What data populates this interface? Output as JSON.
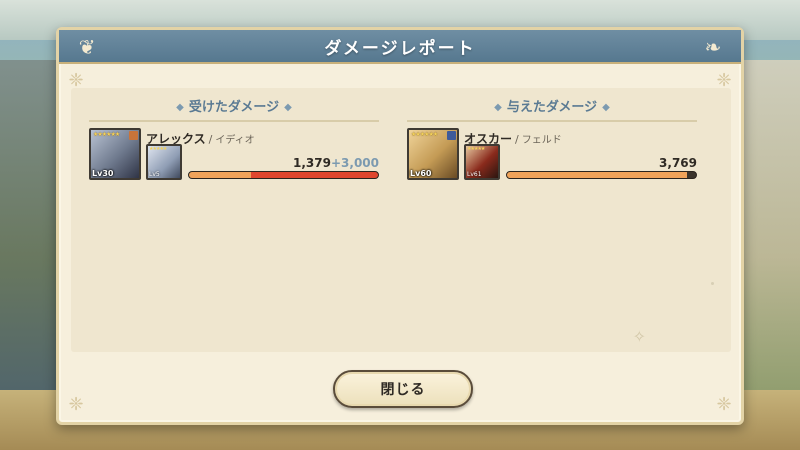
{
  "dialog": {
    "title": "ダメージレポート",
    "close_label": "閉じる"
  },
  "received": {
    "heading": "受けたダメージ",
    "character": {
      "name": "アレックス",
      "separator": "/",
      "sub_name": "イディオ",
      "level": "Lv30",
      "sub_level": "Lv5",
      "damage": "1,379",
      "bonus": "+3,000",
      "bar_primary_fraction": 0.33,
      "bar_bonus_fraction": 0.67
    }
  },
  "dealt": {
    "heading": "与えたダメージ",
    "character": {
      "name": "オスカー",
      "separator": "/",
      "sub_name": "フェルド",
      "level": "Lv60",
      "sub_level": "Lv61",
      "damage": "3,769",
      "bar_primary_fraction": 0.95
    }
  },
  "icons": {
    "header_flourish": "scroll-flourish-icon",
    "title_diamond": "diamond-icon",
    "sparkle": "sparkle-icon"
  },
  "colors": {
    "header": "#56788f",
    "bar_primary": "#f0a35a",
    "bar_bonus": "#e0462e",
    "bonus_text": "#7c9ab0"
  }
}
